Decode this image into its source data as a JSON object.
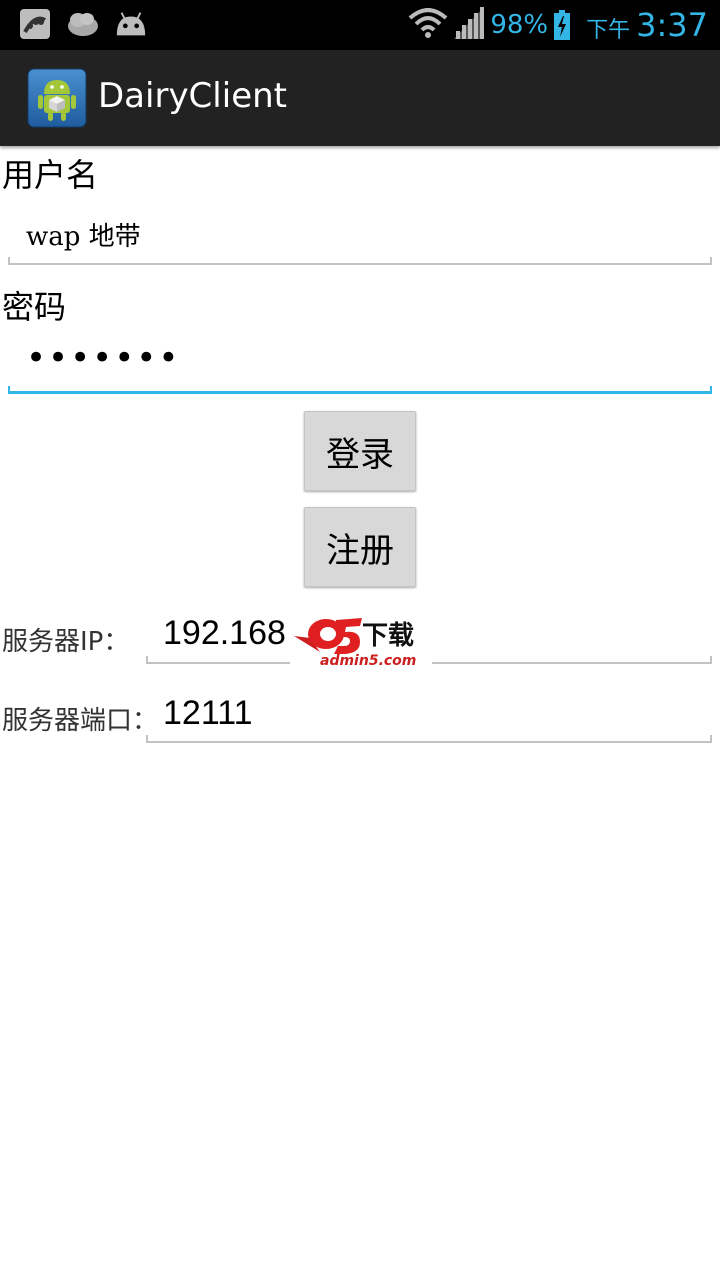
{
  "status_bar": {
    "battery_percent": "98%",
    "ampm": "下午",
    "time": "3:37"
  },
  "action_bar": {
    "title": "DairyClient"
  },
  "form": {
    "username_label": "用户名",
    "username_value": "wap 地带",
    "password_label": "密码",
    "password_value": "•••••••",
    "login_label": "登录",
    "register_label": "注册",
    "server_ip_label": "服务器IP：",
    "server_ip_value": "192.168",
    "server_port_label": "服务器端口：",
    "server_port_value": "12111"
  },
  "watermark": {
    "text": "下载",
    "url": "admin5.com",
    "letter": "a5"
  },
  "colors": {
    "accent": "#33b5e5",
    "actionbar": "#222222",
    "statusbar": "#000000"
  }
}
